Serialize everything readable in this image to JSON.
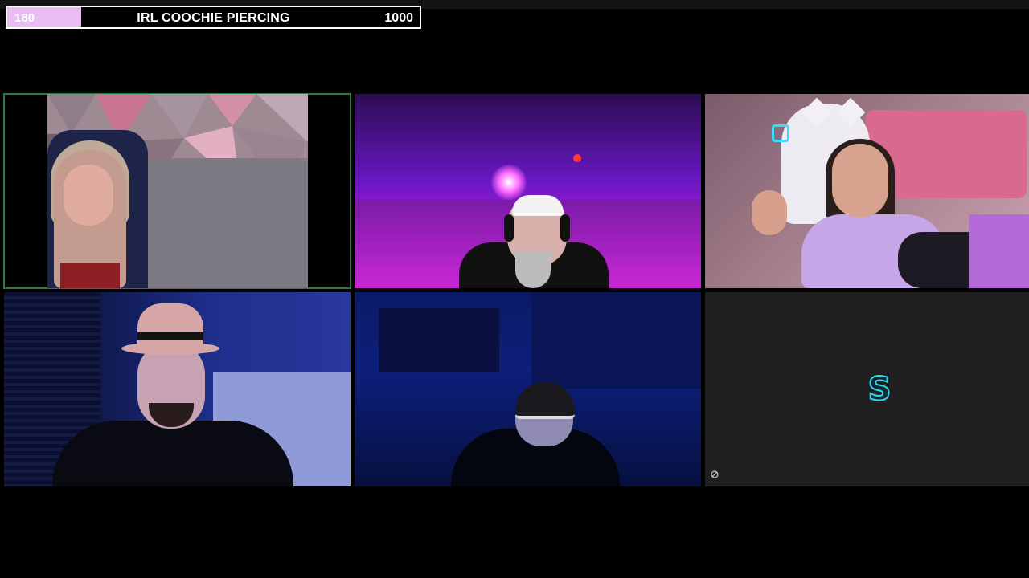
{
  "goal": {
    "current": "180",
    "title": "IRL COOCHIE PIERCING",
    "target": "1000",
    "progress_fraction": 0.18,
    "fill_color": "#e8bdf4",
    "border_color": "#ffffff"
  },
  "tiles": [
    {
      "id": "participant-1",
      "active_speaker": true,
      "highlight_color": "#2f7a3e"
    },
    {
      "id": "participant-2"
    },
    {
      "id": "participant-3"
    },
    {
      "id": "participant-4"
    },
    {
      "id": "participant-5"
    },
    {
      "id": "participant-6",
      "placeholder_logo": "S",
      "logo_color": "#34d4ef",
      "icon": "link-off-icon"
    }
  ]
}
